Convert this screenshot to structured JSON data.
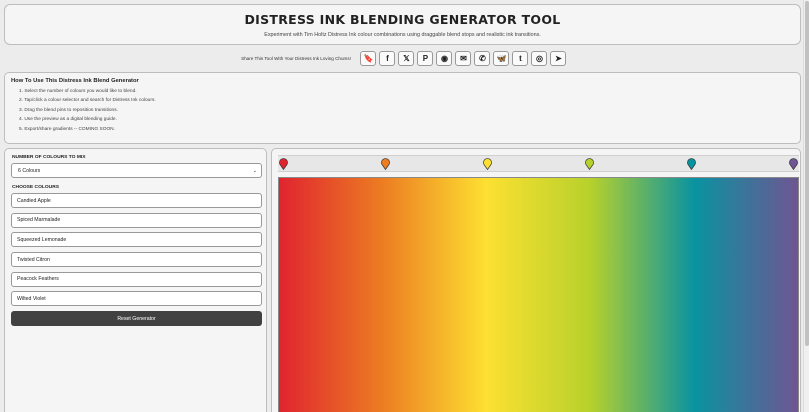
{
  "header": {
    "title": "DISTRESS INK BLENDING GENERATOR TOOL",
    "subtitle": "Experiment with Tim Holtz Distress Ink colour combinations using draggable blend stops and realistic ink transitions."
  },
  "share": {
    "label": "Share This Tool With Your Distress Ink Loving Chums!",
    "buttons": [
      {
        "name": "bookmark-icon",
        "glyph": "🔖"
      },
      {
        "name": "facebook-icon",
        "glyph": "f"
      },
      {
        "name": "x-icon",
        "glyph": "𝕏"
      },
      {
        "name": "pinterest-icon",
        "glyph": "P"
      },
      {
        "name": "reddit-icon",
        "glyph": "◉"
      },
      {
        "name": "email-icon",
        "glyph": "✉"
      },
      {
        "name": "whatsapp-icon",
        "glyph": "✆"
      },
      {
        "name": "bluesky-icon",
        "glyph": "🦋"
      },
      {
        "name": "tumblr-icon",
        "glyph": "t"
      },
      {
        "name": "instagram-icon",
        "glyph": "◎"
      },
      {
        "name": "telegram-icon",
        "glyph": "➤"
      }
    ]
  },
  "howto": {
    "title": "How To Use This Distress Ink Blend Generator",
    "steps": [
      "1. Select the number of colours you would like to blend.",
      "2. Tap/click a colour selector and search for Distress Ink colours.",
      "3. Drag the blend pins to reposition transitions.",
      "4. Use the preview as a digital blending guide.",
      "5. Export/share gradients -- COMING SOON."
    ]
  },
  "controls": {
    "count_label": "NUMBER OF COLOURS TO MIX",
    "count_value": "6 Colours",
    "choose_label": "CHOOSE COLOURS",
    "colours": [
      "Candied Apple",
      "Spiced Marmalade",
      "Squeezed Lemonade",
      "Twisted Citron",
      "Peacock Feathers",
      "Wilted Violet"
    ],
    "reset_label": "Reset Generator"
  },
  "preview": {
    "stops": [
      {
        "name": "Candied Apple",
        "color": "#e0242f",
        "position": 0
      },
      {
        "name": "Spiced Marmalade",
        "color": "#ec7d22",
        "position": 20
      },
      {
        "name": "Squeezed Lemonade",
        "color": "#fde031",
        "position": 40
      },
      {
        "name": "Twisted Citron",
        "color": "#b7d12c",
        "position": 60
      },
      {
        "name": "Peacock Feathers",
        "color": "#0993a1",
        "position": 80
      },
      {
        "name": "Wilted Violet",
        "color": "#6f5592",
        "position": 100
      }
    ]
  }
}
